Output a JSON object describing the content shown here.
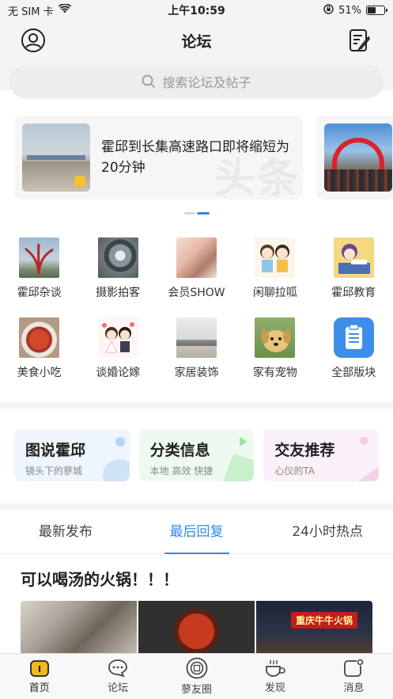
{
  "status_bar": {
    "carrier": "无 SIM 卡",
    "time": "上午10:59",
    "battery_percent": "51%",
    "battery_level": 0.51
  },
  "nav": {
    "title": "论坛"
  },
  "search": {
    "placeholder": "搜索论坛及帖子"
  },
  "banner": {
    "items": [
      {
        "title": "霍邱到长集高速路口即将缩短为20分钟",
        "watermark": "头条"
      }
    ],
    "page_count": 2,
    "active_index": 1
  },
  "categories": [
    {
      "label": "霍邱杂谈",
      "icon": "sculpture-photo"
    },
    {
      "label": "摄影拍客",
      "icon": "camera-lens-photo"
    },
    {
      "label": "会员SHOW",
      "icon": "portrait-photo"
    },
    {
      "label": "闲聊拉呱",
      "icon": "cartoon-chat-photo"
    },
    {
      "label": "霍邱教育",
      "icon": "cartoon-study-photo"
    },
    {
      "label": "美食小吃",
      "icon": "food-bowl-photo"
    },
    {
      "label": "谈婚论嫁",
      "icon": "cartoon-couple-photo"
    },
    {
      "label": "家居装饰",
      "icon": "living-room-photo"
    },
    {
      "label": "家有宠物",
      "icon": "puppy-photo"
    },
    {
      "label": "全部版块",
      "icon": "clipboard-icon"
    }
  ],
  "features": [
    {
      "title": "图说霍邱",
      "subtitle": "镜头下的蓼城"
    },
    {
      "title": "分类信息",
      "subtitle": "本地 高效 快捷"
    },
    {
      "title": "交友推荐",
      "subtitle": "心仪的TA"
    }
  ],
  "tabs": [
    {
      "label": "最新发布"
    },
    {
      "label": "最后回复"
    },
    {
      "label": "24小时热点"
    }
  ],
  "active_tab": 1,
  "post": {
    "title": "可以喝汤的火锅！！！",
    "sign_text": "重庆牛牛火锅"
  },
  "tabbar": [
    {
      "label": "首页",
      "icon": "home-icon"
    },
    {
      "label": "论坛",
      "icon": "chat-bubble-icon"
    },
    {
      "label": "蓼友圈",
      "icon": "circle-icon"
    },
    {
      "label": "发现",
      "icon": "coffee-cup-icon"
    },
    {
      "label": "消息",
      "icon": "message-icon"
    }
  ],
  "colors": {
    "accent": "#2f8be6",
    "home_active": "#f2b91b"
  }
}
